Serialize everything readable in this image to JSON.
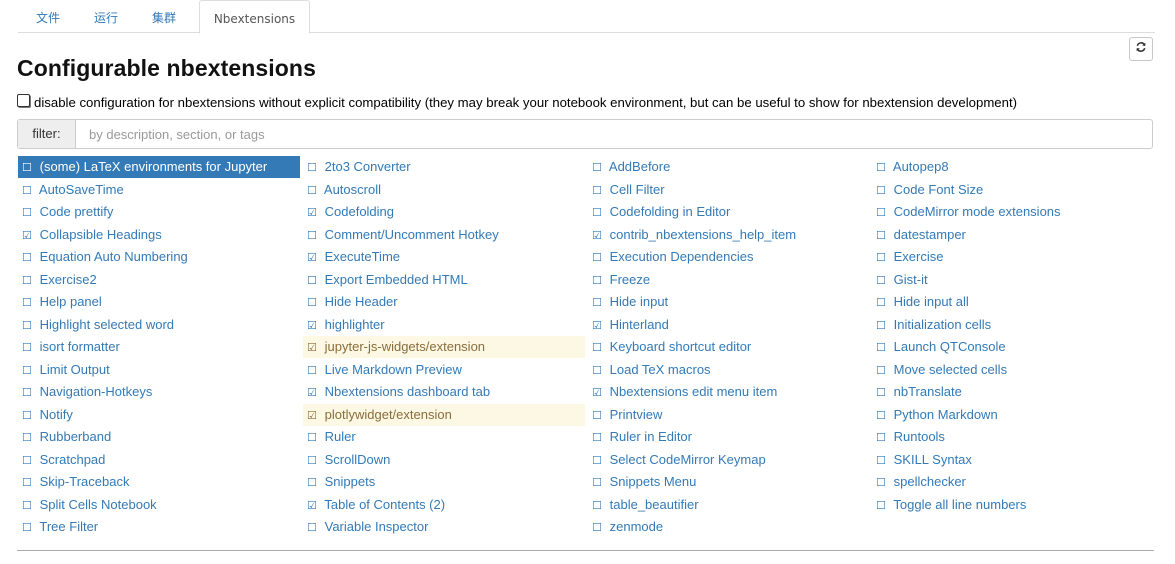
{
  "tabs": [
    {
      "label": "文件",
      "active": false
    },
    {
      "label": "运行",
      "active": false
    },
    {
      "label": "集群",
      "active": false
    },
    {
      "label": "Nbextensions",
      "active": true
    }
  ],
  "refresh_icon": "refresh-icon",
  "title": "Configurable nbextensions",
  "compat": {
    "checked": false,
    "label": "disable configuration for nbextensions without explicit compatibility (they may break your notebook environment, but can be useful to show for nbextension development)"
  },
  "filter": {
    "label": "filter:",
    "placeholder": "by description, section, or tags",
    "value": ""
  },
  "colors": {
    "link": "#337ab7",
    "selected_bg": "#337ab7",
    "warn_bg": "#fcf8e3",
    "warn_text": "#8a6d3b"
  },
  "extensions": [
    [
      {
        "label": "(some) LaTeX environments for Jupyter",
        "checked": false,
        "state": "selected"
      },
      {
        "label": "AutoSaveTime",
        "checked": false
      },
      {
        "label": "Code prettify",
        "checked": false
      },
      {
        "label": "Collapsible Headings",
        "checked": true
      },
      {
        "label": "Equation Auto Numbering",
        "checked": false
      },
      {
        "label": "Exercise2",
        "checked": false
      },
      {
        "label": "Help panel",
        "checked": false
      },
      {
        "label": "Highlight selected word",
        "checked": false
      },
      {
        "label": "isort formatter",
        "checked": false
      },
      {
        "label": "Limit Output",
        "checked": false
      },
      {
        "label": "Navigation-Hotkeys",
        "checked": false
      },
      {
        "label": "Notify",
        "checked": false
      },
      {
        "label": "Rubberband",
        "checked": false
      },
      {
        "label": "Scratchpad",
        "checked": false
      },
      {
        "label": "Skip-Traceback",
        "checked": false
      },
      {
        "label": "Split Cells Notebook",
        "checked": false
      },
      {
        "label": "Tree Filter",
        "checked": false
      }
    ],
    [
      {
        "label": "2to3 Converter",
        "checked": false
      },
      {
        "label": "Autoscroll",
        "checked": false
      },
      {
        "label": "Codefolding",
        "checked": true
      },
      {
        "label": "Comment/Uncomment Hotkey",
        "checked": false
      },
      {
        "label": "ExecuteTime",
        "checked": true
      },
      {
        "label": "Export Embedded HTML",
        "checked": false
      },
      {
        "label": "Hide Header",
        "checked": false
      },
      {
        "label": "highlighter",
        "checked": true
      },
      {
        "label": "jupyter-js-widgets/extension",
        "checked": true,
        "state": "warn"
      },
      {
        "label": "Live Markdown Preview",
        "checked": false
      },
      {
        "label": "Nbextensions dashboard tab",
        "checked": true
      },
      {
        "label": "plotlywidget/extension",
        "checked": true,
        "state": "warn"
      },
      {
        "label": "Ruler",
        "checked": false
      },
      {
        "label": "ScrollDown",
        "checked": false
      },
      {
        "label": "Snippets",
        "checked": false
      },
      {
        "label": "Table of Contents (2)",
        "checked": true
      },
      {
        "label": "Variable Inspector",
        "checked": false
      }
    ],
    [
      {
        "label": "AddBefore",
        "checked": false
      },
      {
        "label": "Cell Filter",
        "checked": false
      },
      {
        "label": "Codefolding in Editor",
        "checked": false
      },
      {
        "label": "contrib_nbextensions_help_item",
        "checked": true
      },
      {
        "label": "Execution Dependencies",
        "checked": false
      },
      {
        "label": "Freeze",
        "checked": false
      },
      {
        "label": "Hide input",
        "checked": false
      },
      {
        "label": "Hinterland",
        "checked": true
      },
      {
        "label": "Keyboard shortcut editor",
        "checked": false
      },
      {
        "label": "Load TeX macros",
        "checked": false
      },
      {
        "label": "Nbextensions edit menu item",
        "checked": true
      },
      {
        "label": "Printview",
        "checked": false
      },
      {
        "label": "Ruler in Editor",
        "checked": false
      },
      {
        "label": "Select CodeMirror Keymap",
        "checked": false
      },
      {
        "label": "Snippets Menu",
        "checked": false
      },
      {
        "label": "table_beautifier",
        "checked": false
      },
      {
        "label": "zenmode",
        "checked": false
      }
    ],
    [
      {
        "label": "Autopep8",
        "checked": false
      },
      {
        "label": "Code Font Size",
        "checked": false
      },
      {
        "label": "CodeMirror mode extensions",
        "checked": false
      },
      {
        "label": "datestamper",
        "checked": false
      },
      {
        "label": "Exercise",
        "checked": false
      },
      {
        "label": "Gist-it",
        "checked": false
      },
      {
        "label": "Hide input all",
        "checked": false
      },
      {
        "label": "Initialization cells",
        "checked": false
      },
      {
        "label": "Launch QTConsole",
        "checked": false
      },
      {
        "label": "Move selected cells",
        "checked": false
      },
      {
        "label": "nbTranslate",
        "checked": false
      },
      {
        "label": "Python Markdown",
        "checked": false
      },
      {
        "label": "Runtools",
        "checked": false
      },
      {
        "label": "SKILL Syntax",
        "checked": false
      },
      {
        "label": "spellchecker",
        "checked": false
      },
      {
        "label": "Toggle all line numbers",
        "checked": false
      }
    ]
  ]
}
